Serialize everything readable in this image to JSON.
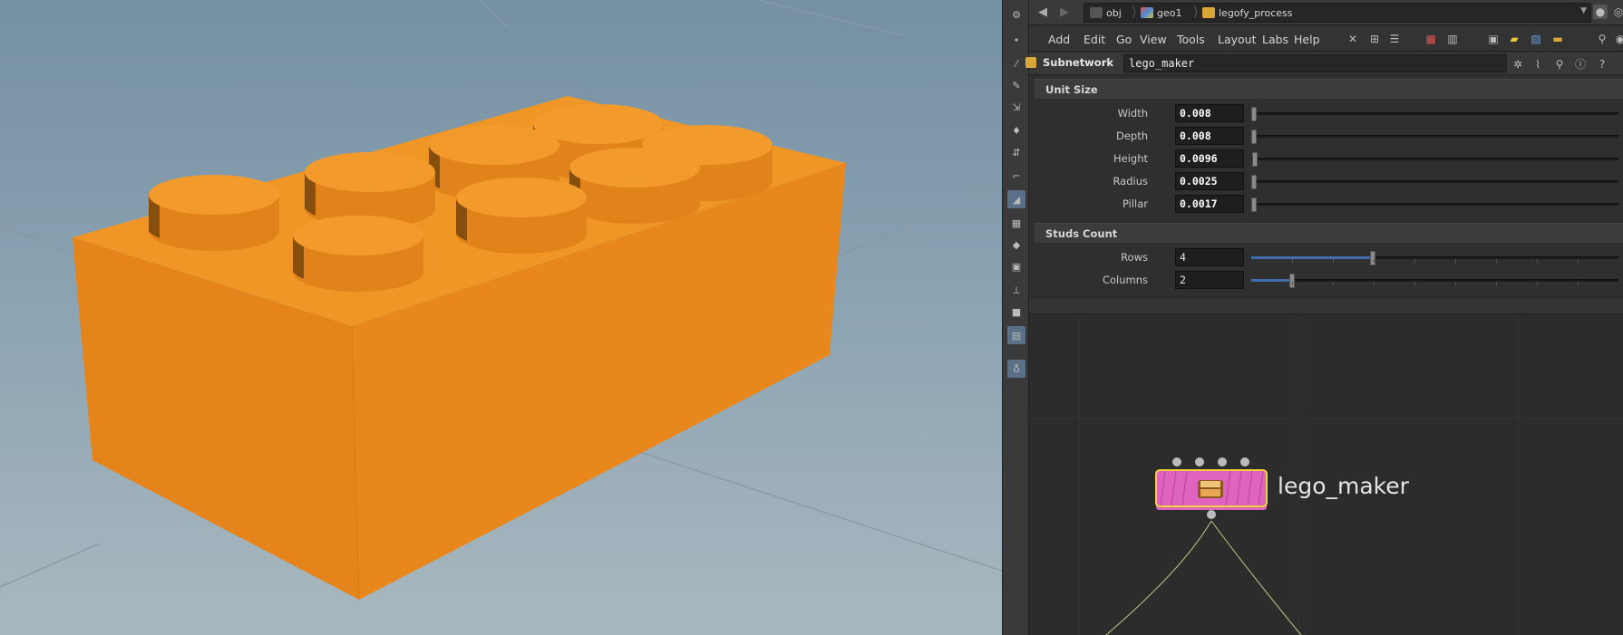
{
  "pathbar": {
    "crumbs": [
      {
        "label": "obj",
        "icon": "network-icon"
      },
      {
        "label": "geo1",
        "icon": "geometry-icon"
      },
      {
        "label": "legofy_process",
        "icon": "subnet-icon"
      }
    ]
  },
  "menubar": {
    "items": [
      "Add",
      "Edit",
      "Go",
      "View",
      "Tools",
      "Layout",
      "Labs",
      "Help"
    ]
  },
  "operator": {
    "type": "Subnetwork",
    "name": "lego_maker"
  },
  "folders": {
    "unit_size": {
      "label": "Unit Size",
      "parms": [
        {
          "label": "Width",
          "value": "0.008"
        },
        {
          "label": "Depth",
          "value": "0.008"
        },
        {
          "label": "Height",
          "value": "0.0096"
        },
        {
          "label": "Radius",
          "value": "0.0025"
        },
        {
          "label": "Pillar",
          "value": "0.0017"
        }
      ]
    },
    "studs_count": {
      "label": "Studs Count",
      "parms": [
        {
          "label": "Rows",
          "value": "4",
          "fraction": 0.33
        },
        {
          "label": "Columns",
          "value": "2",
          "fraction": 0.11
        }
      ]
    }
  },
  "network": {
    "node_label": "lego_maker",
    "node_color": "#e063c0",
    "selected_outline": "#f2d23c"
  },
  "viewport": {
    "brick_color": "#e88a1d"
  }
}
